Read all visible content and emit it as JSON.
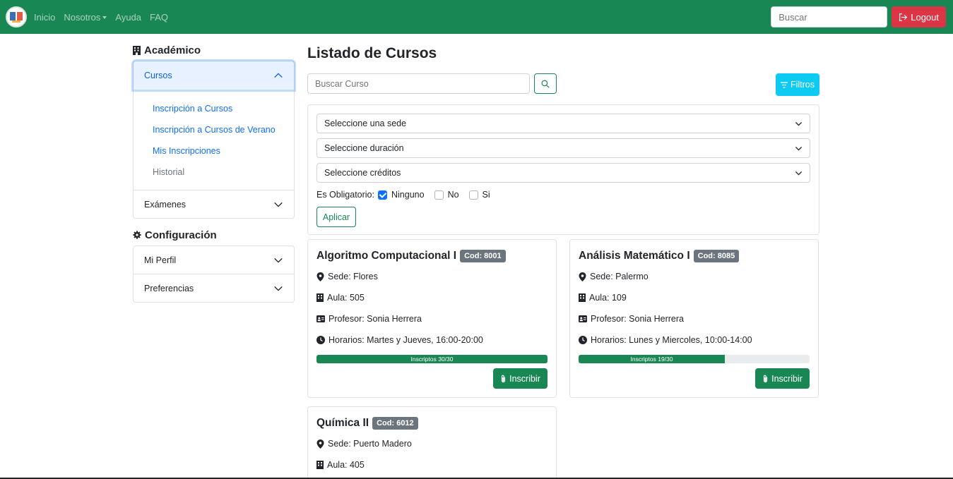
{
  "colors": {
    "navbar": "#198754",
    "danger": "#dc3545",
    "info": "#0dcaf0",
    "primary": "#0d6efd",
    "secondary": "#6c757d"
  },
  "navbar": {
    "logo_icon": "school-logo",
    "links": [
      "Inicio",
      "Nosotros",
      "Ayuda",
      "FAQ"
    ],
    "search_placeholder": "Buscar",
    "logout_label": "Logout"
  },
  "sidebar": {
    "academico": {
      "title": "Académico",
      "cursos_label": "Cursos",
      "cursos_links": [
        "Inscripción a Cursos",
        "Inscripción a Cursos de Verano",
        "Mis Inscripciones",
        "Historial"
      ],
      "examenes_label": "Exámenes"
    },
    "config": {
      "title": "Configuración",
      "items": [
        "Mi Perfil",
        "Preferencias"
      ]
    }
  },
  "main": {
    "title": "Listado de Cursos",
    "search_placeholder": "Buscar Curso",
    "filtros_label": "Filtros",
    "filters": {
      "selects": [
        "Seleccione una sede",
        "Seleccione duración",
        "Seleccione créditos"
      ],
      "obligatorio_label": "Es Obligatorio:",
      "options": [
        {
          "label": "Ninguno",
          "checked": true
        },
        {
          "label": "No",
          "checked": false
        },
        {
          "label": "Si",
          "checked": false
        }
      ],
      "apply_label": "Aplicar"
    },
    "courses": [
      {
        "name": "Algoritmo Computacional I",
        "code": "Cod: 8001",
        "sede": "Sede: Flores",
        "aula": "Aula: 505",
        "profesor": "Profesor: Sonia Herrera",
        "horarios": "Horarios: Martes y Jueves, 16:00-20:00",
        "progress_label": "Inscriptos 30/30",
        "fill": 1.0,
        "action": "Inscribir"
      },
      {
        "name": "Análisis Matemático I",
        "code": "Cod: 8085",
        "sede": "Sede: Palermo",
        "aula": "Aula: 109",
        "profesor": "Profesor: Sonia Herrera",
        "horarios": "Horarios: Lunes y Miercoles, 10:00-14:00",
        "progress_label": "Inscriptos 19/30",
        "fill": 0.633,
        "action": "Inscribir"
      },
      {
        "name": "Química II",
        "code": "Cod: 6012",
        "sede": "Sede: Puerto Madero",
        "aula": "Aula: 405"
      }
    ]
  }
}
